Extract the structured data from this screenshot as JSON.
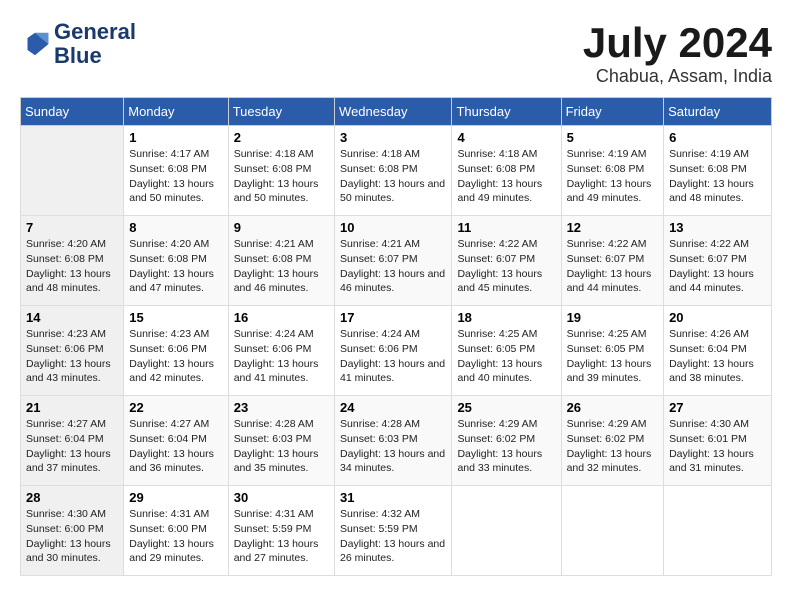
{
  "header": {
    "logo_line1": "General",
    "logo_line2": "Blue",
    "month_year": "July 2024",
    "location": "Chabua, Assam, India"
  },
  "columns": [
    "Sunday",
    "Monday",
    "Tuesday",
    "Wednesday",
    "Thursday",
    "Friday",
    "Saturday"
  ],
  "weeks": [
    [
      {
        "day": "",
        "sunrise": "",
        "sunset": "",
        "daylight": ""
      },
      {
        "day": "1",
        "sunrise": "Sunrise: 4:17 AM",
        "sunset": "Sunset: 6:08 PM",
        "daylight": "Daylight: 13 hours and 50 minutes."
      },
      {
        "day": "2",
        "sunrise": "Sunrise: 4:18 AM",
        "sunset": "Sunset: 6:08 PM",
        "daylight": "Daylight: 13 hours and 50 minutes."
      },
      {
        "day": "3",
        "sunrise": "Sunrise: 4:18 AM",
        "sunset": "Sunset: 6:08 PM",
        "daylight": "Daylight: 13 hours and 50 minutes."
      },
      {
        "day": "4",
        "sunrise": "Sunrise: 4:18 AM",
        "sunset": "Sunset: 6:08 PM",
        "daylight": "Daylight: 13 hours and 49 minutes."
      },
      {
        "day": "5",
        "sunrise": "Sunrise: 4:19 AM",
        "sunset": "Sunset: 6:08 PM",
        "daylight": "Daylight: 13 hours and 49 minutes."
      },
      {
        "day": "6",
        "sunrise": "Sunrise: 4:19 AM",
        "sunset": "Sunset: 6:08 PM",
        "daylight": "Daylight: 13 hours and 48 minutes."
      }
    ],
    [
      {
        "day": "7",
        "sunrise": "Sunrise: 4:20 AM",
        "sunset": "Sunset: 6:08 PM",
        "daylight": "Daylight: 13 hours and 48 minutes."
      },
      {
        "day": "8",
        "sunrise": "Sunrise: 4:20 AM",
        "sunset": "Sunset: 6:08 PM",
        "daylight": "Daylight: 13 hours and 47 minutes."
      },
      {
        "day": "9",
        "sunrise": "Sunrise: 4:21 AM",
        "sunset": "Sunset: 6:08 PM",
        "daylight": "Daylight: 13 hours and 46 minutes."
      },
      {
        "day": "10",
        "sunrise": "Sunrise: 4:21 AM",
        "sunset": "Sunset: 6:07 PM",
        "daylight": "Daylight: 13 hours and 46 minutes."
      },
      {
        "day": "11",
        "sunrise": "Sunrise: 4:22 AM",
        "sunset": "Sunset: 6:07 PM",
        "daylight": "Daylight: 13 hours and 45 minutes."
      },
      {
        "day": "12",
        "sunrise": "Sunrise: 4:22 AM",
        "sunset": "Sunset: 6:07 PM",
        "daylight": "Daylight: 13 hours and 44 minutes."
      },
      {
        "day": "13",
        "sunrise": "Sunrise: 4:22 AM",
        "sunset": "Sunset: 6:07 PM",
        "daylight": "Daylight: 13 hours and 44 minutes."
      }
    ],
    [
      {
        "day": "14",
        "sunrise": "Sunrise: 4:23 AM",
        "sunset": "Sunset: 6:06 PM",
        "daylight": "Daylight: 13 hours and 43 minutes."
      },
      {
        "day": "15",
        "sunrise": "Sunrise: 4:23 AM",
        "sunset": "Sunset: 6:06 PM",
        "daylight": "Daylight: 13 hours and 42 minutes."
      },
      {
        "day": "16",
        "sunrise": "Sunrise: 4:24 AM",
        "sunset": "Sunset: 6:06 PM",
        "daylight": "Daylight: 13 hours and 41 minutes."
      },
      {
        "day": "17",
        "sunrise": "Sunrise: 4:24 AM",
        "sunset": "Sunset: 6:06 PM",
        "daylight": "Daylight: 13 hours and 41 minutes."
      },
      {
        "day": "18",
        "sunrise": "Sunrise: 4:25 AM",
        "sunset": "Sunset: 6:05 PM",
        "daylight": "Daylight: 13 hours and 40 minutes."
      },
      {
        "day": "19",
        "sunrise": "Sunrise: 4:25 AM",
        "sunset": "Sunset: 6:05 PM",
        "daylight": "Daylight: 13 hours and 39 minutes."
      },
      {
        "day": "20",
        "sunrise": "Sunrise: 4:26 AM",
        "sunset": "Sunset: 6:04 PM",
        "daylight": "Daylight: 13 hours and 38 minutes."
      }
    ],
    [
      {
        "day": "21",
        "sunrise": "Sunrise: 4:27 AM",
        "sunset": "Sunset: 6:04 PM",
        "daylight": "Daylight: 13 hours and 37 minutes."
      },
      {
        "day": "22",
        "sunrise": "Sunrise: 4:27 AM",
        "sunset": "Sunset: 6:04 PM",
        "daylight": "Daylight: 13 hours and 36 minutes."
      },
      {
        "day": "23",
        "sunrise": "Sunrise: 4:28 AM",
        "sunset": "Sunset: 6:03 PM",
        "daylight": "Daylight: 13 hours and 35 minutes."
      },
      {
        "day": "24",
        "sunrise": "Sunrise: 4:28 AM",
        "sunset": "Sunset: 6:03 PM",
        "daylight": "Daylight: 13 hours and 34 minutes."
      },
      {
        "day": "25",
        "sunrise": "Sunrise: 4:29 AM",
        "sunset": "Sunset: 6:02 PM",
        "daylight": "Daylight: 13 hours and 33 minutes."
      },
      {
        "day": "26",
        "sunrise": "Sunrise: 4:29 AM",
        "sunset": "Sunset: 6:02 PM",
        "daylight": "Daylight: 13 hours and 32 minutes."
      },
      {
        "day": "27",
        "sunrise": "Sunrise: 4:30 AM",
        "sunset": "Sunset: 6:01 PM",
        "daylight": "Daylight: 13 hours and 31 minutes."
      }
    ],
    [
      {
        "day": "28",
        "sunrise": "Sunrise: 4:30 AM",
        "sunset": "Sunset: 6:00 PM",
        "daylight": "Daylight: 13 hours and 30 minutes."
      },
      {
        "day": "29",
        "sunrise": "Sunrise: 4:31 AM",
        "sunset": "Sunset: 6:00 PM",
        "daylight": "Daylight: 13 hours and 29 minutes."
      },
      {
        "day": "30",
        "sunrise": "Sunrise: 4:31 AM",
        "sunset": "Sunset: 5:59 PM",
        "daylight": "Daylight: 13 hours and 27 minutes."
      },
      {
        "day": "31",
        "sunrise": "Sunrise: 4:32 AM",
        "sunset": "Sunset: 5:59 PM",
        "daylight": "Daylight: 13 hours and 26 minutes."
      },
      {
        "day": "",
        "sunrise": "",
        "sunset": "",
        "daylight": ""
      },
      {
        "day": "",
        "sunrise": "",
        "sunset": "",
        "daylight": ""
      },
      {
        "day": "",
        "sunrise": "",
        "sunset": "",
        "daylight": ""
      }
    ]
  ]
}
